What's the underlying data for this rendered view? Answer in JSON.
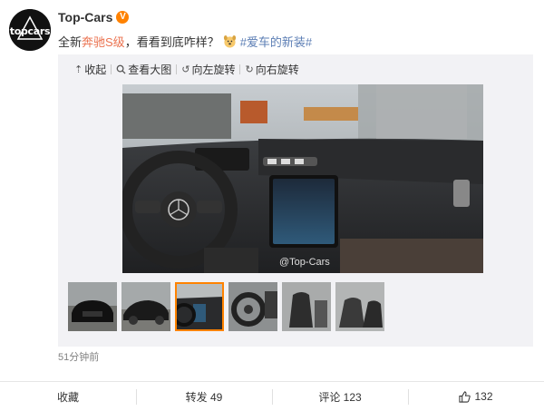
{
  "post": {
    "username": "Top-Cars",
    "verified_badge": "V",
    "avatar_text": "topcars",
    "text_prefix": "全新",
    "text_link": "奔驰S级",
    "text_middle": "，看看到底咋样？",
    "text_topic": "#爱车的新装#",
    "time": "51分钟前"
  },
  "media_toolbar": {
    "collapse": "收起",
    "view_large": "查看大图",
    "rotate_left": "向左旋转",
    "rotate_right": "向右旋转"
  },
  "photo": {
    "watermark": "@Top-Cars"
  },
  "thumbnails": [
    {
      "label": "front-exterior",
      "active": false
    },
    {
      "label": "side-exterior",
      "active": false
    },
    {
      "label": "dashboard-interior",
      "active": true
    },
    {
      "label": "steering-wheel",
      "active": false
    },
    {
      "label": "seats-interior",
      "active": false
    },
    {
      "label": "rear-seats",
      "active": false
    }
  ],
  "actions": {
    "favorite": "收藏",
    "repost": "转发 49",
    "comment": "评论 123",
    "like": "132"
  },
  "colors": {
    "accent": "#ff8200",
    "link": "#eb7350",
    "topic": "#5d7fb5"
  }
}
